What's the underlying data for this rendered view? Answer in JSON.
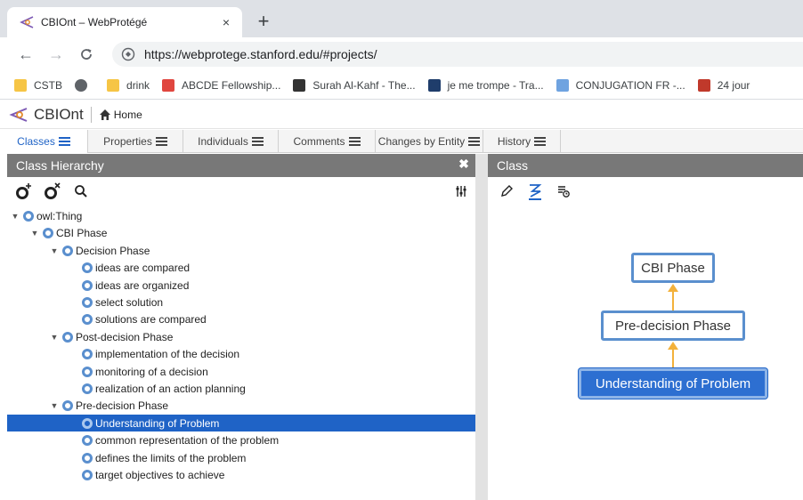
{
  "browser": {
    "tab_title": "CBIOnt – WebProtégé",
    "tab_close": "×",
    "new_tab": "+",
    "url": "https://webprotege.stanford.edu/#projects/",
    "bookmarks": [
      {
        "label": "CSTB",
        "color": "#f6c545"
      },
      {
        "label": "",
        "color": "#5f6368"
      },
      {
        "label": "drink",
        "color": "#f6c545"
      },
      {
        "label": "ABCDE Fellowship...",
        "color": "#e0463f"
      },
      {
        "label": "Surah Al-Kahf - The...",
        "color": "#333333"
      },
      {
        "label": "je me trompe - Tra...",
        "color": "#1f3d6b"
      },
      {
        "label": "CONJUGATION FR -...",
        "color": "#6fa3e0"
      },
      {
        "label": "24 jour",
        "color": "#c0392b"
      }
    ]
  },
  "app": {
    "project_name": "CBIOnt",
    "home_label": "Home",
    "accent": "#1f63c6"
  },
  "tabs": [
    {
      "label": "Classes",
      "active": true
    },
    {
      "label": "Properties",
      "active": false
    },
    {
      "label": "Individuals",
      "active": false
    },
    {
      "label": "Comments",
      "active": false
    },
    {
      "label": "Changes by Entity",
      "active": false
    },
    {
      "label": "History",
      "active": false
    }
  ],
  "left_panel": {
    "title": "Class Hierarchy",
    "close": "✖"
  },
  "right_panel": {
    "title": "Class"
  },
  "tree": [
    {
      "label": "owl:Thing",
      "depth": 0,
      "expanded": true
    },
    {
      "label": "CBI Phase",
      "depth": 1,
      "expanded": true
    },
    {
      "label": "Decision Phase",
      "depth": 2,
      "expanded": true
    },
    {
      "label": "ideas are compared",
      "depth": 3
    },
    {
      "label": "ideas are organized",
      "depth": 3
    },
    {
      "label": "select solution",
      "depth": 3
    },
    {
      "label": "solutions are compared",
      "depth": 3
    },
    {
      "label": "Post-decision Phase",
      "depth": 2,
      "expanded": true
    },
    {
      "label": "implementation of the decision",
      "depth": 3
    },
    {
      "label": "monitoring of a decision",
      "depth": 3
    },
    {
      "label": "realization of an action planning",
      "depth": 3
    },
    {
      "label": "Pre-decision Phase",
      "depth": 2,
      "expanded": true
    },
    {
      "label": "Understanding of Problem",
      "depth": 3,
      "selected": true
    },
    {
      "label": "common representation of the problem",
      "depth": 3
    },
    {
      "label": "defines the limits of the problem",
      "depth": 3
    },
    {
      "label": "target objectives to achieve",
      "depth": 3
    }
  ],
  "graph": {
    "nodes": [
      "CBI Phase",
      "Pre-decision Phase",
      "Understanding of Problem"
    ],
    "selected": "Understanding of Problem",
    "edge_color": "#f3b13b"
  }
}
